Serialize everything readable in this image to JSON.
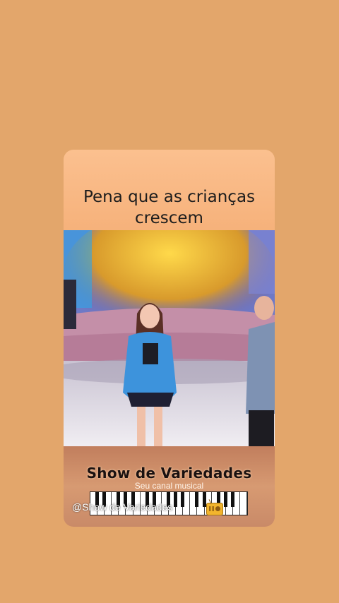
{
  "post": {
    "caption": "Pena que as crianças crescem"
  },
  "brand": {
    "title": "Show de Variedades",
    "subtitle": "Seu canal musical",
    "handle": "@Show de Variedades"
  },
  "icons": {
    "piano": "piano-keys-icon",
    "radio": "radio-icon"
  },
  "colors": {
    "background": "#e3a66b",
    "card": "#f6b17a",
    "brand_banner": "#c98a68"
  }
}
